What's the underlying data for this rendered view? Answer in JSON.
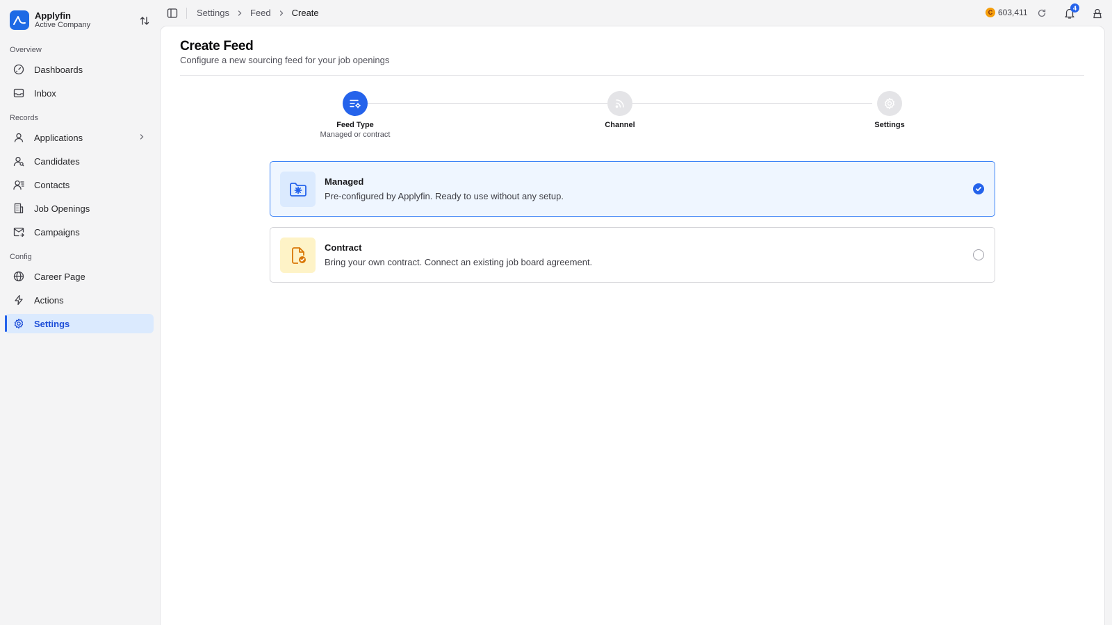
{
  "brand": {
    "name": "Applyfin",
    "subtitle": "Active Company",
    "accent": "#1d6ae5"
  },
  "sidebar": {
    "sections": {
      "overview": "Overview",
      "records": "Records",
      "config": "Config"
    },
    "items": [
      {
        "label": "Dashboards",
        "icon": "gauge-icon"
      },
      {
        "label": "Inbox",
        "icon": "inbox-icon"
      },
      {
        "label": "Applications",
        "icon": "user-icon"
      },
      {
        "label": "Candidates",
        "icon": "user-search-icon"
      },
      {
        "label": "Contacts",
        "icon": "contacts-icon"
      },
      {
        "label": "Job Openings",
        "icon": "building-icon"
      },
      {
        "label": "Campaigns",
        "icon": "mail-send-icon"
      },
      {
        "label": "Career Page",
        "icon": "globe-icon"
      },
      {
        "label": "Actions",
        "icon": "zap-icon"
      },
      {
        "label": "Settings",
        "icon": "gear-icon",
        "active": true
      }
    ]
  },
  "topbar": {
    "breadcrumb": [
      "Settings",
      "Feed",
      "Create"
    ],
    "credits": "603,411",
    "coin_symbol": "C",
    "notification_count": "4"
  },
  "page": {
    "title": "Create Feed",
    "subtitle": "Configure a new sourcing feed for your job openings"
  },
  "stepper": {
    "steps": [
      {
        "label": "Feed Type",
        "description": "Managed or contract",
        "state": "active",
        "icon": "list-settings-icon"
      },
      {
        "label": "Channel",
        "description": "",
        "state": "inactive",
        "icon": "rss-icon"
      },
      {
        "label": "Settings",
        "description": "",
        "state": "inactive",
        "icon": "gear-icon"
      }
    ]
  },
  "options": [
    {
      "title": "Managed",
      "description": "Pre-configured by Applyfin. Ready to use without any setup.",
      "selected": true,
      "icon": "folder-cog-icon",
      "color": "#2563eb"
    },
    {
      "title": "Contract",
      "description": "Bring your own contract. Connect an existing job board agreement.",
      "selected": false,
      "icon": "file-check-icon",
      "color": "#d97706"
    }
  ]
}
